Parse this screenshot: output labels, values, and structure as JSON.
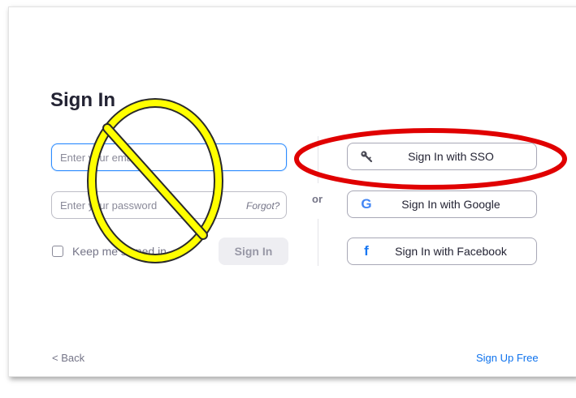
{
  "title": "Sign In",
  "email": {
    "placeholder": "Enter your email"
  },
  "password": {
    "placeholder": "Enter your password",
    "forgot_label": "Forgot?"
  },
  "keep_signed_in": {
    "label": "Keep me signed in",
    "checked": false
  },
  "sign_in_button": "Sign In",
  "divider_label": "or",
  "sso_options": {
    "sso": {
      "label": "Sign In with SSO",
      "icon": "key-icon"
    },
    "google": {
      "label": "Sign In with Google",
      "icon": "google-icon",
      "glyph": "G"
    },
    "facebook": {
      "label": "Sign In with Facebook",
      "icon": "facebook-icon",
      "glyph": "f"
    }
  },
  "footer": {
    "back_label": "< Back",
    "signup_label": "Sign Up Free"
  },
  "annotations": {
    "prohibited_symbol_color": "#ffff00",
    "highlight_ellipse_color": "#e00000"
  },
  "colors": {
    "accent": "#2d8cff",
    "link": "#0e72ed",
    "text": "#232333",
    "muted": "#747487"
  }
}
